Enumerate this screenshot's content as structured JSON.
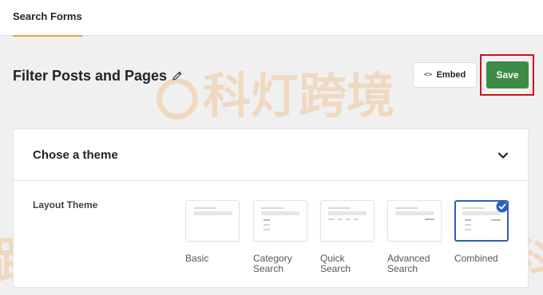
{
  "tabs": [
    {
      "label": "Search Forms",
      "active": true
    }
  ],
  "header": {
    "title": "Filter Posts and Pages",
    "edit_icon": "pencil-icon",
    "embed_label": "Embed",
    "embed_icon": "code-icon",
    "save_label": "Save"
  },
  "theme_section": {
    "title": "Chose a theme",
    "toggle_icon": "chevron-down-icon",
    "layout_label": "Layout Theme",
    "themes": [
      {
        "label_line1": "Basic",
        "label_line2": "",
        "selected": false
      },
      {
        "label_line1": "Category",
        "label_line2": "Search",
        "selected": false
      },
      {
        "label_line1": "Quick",
        "label_line2": "Search",
        "selected": false
      },
      {
        "label_line1": "Advanced",
        "label_line2": "Search",
        "selected": false
      },
      {
        "label_line1": "Combined",
        "label_line2": "",
        "selected": true
      }
    ]
  },
  "watermark": {
    "text_center": "科灯跨境",
    "text_left": "跨境",
    "text_right": "科"
  },
  "colors": {
    "accent_tab": "#e8a33d",
    "save_button": "#3d8b47",
    "highlight_outline": "#d0111b",
    "selected_theme": "#2b62b8"
  }
}
